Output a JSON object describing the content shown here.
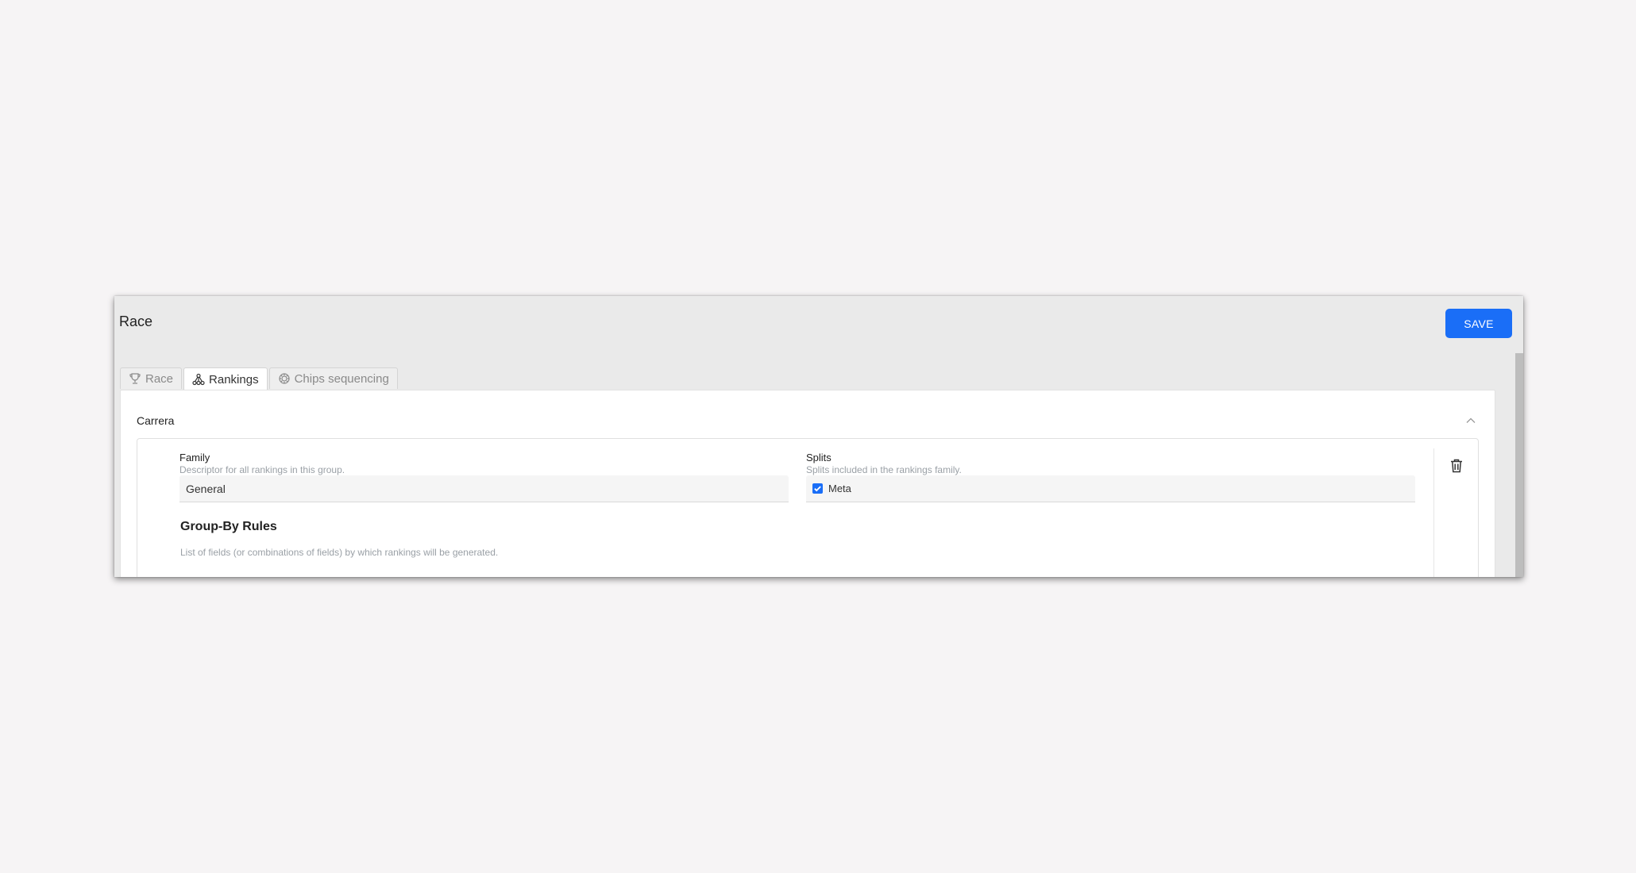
{
  "dialog": {
    "title": "Race",
    "save_label": "SAVE"
  },
  "tabs": [
    {
      "label": "Race",
      "icon": "trophy-icon",
      "active": false
    },
    {
      "label": "Rankings",
      "icon": "ranking-tree-icon",
      "active": true
    },
    {
      "label": "Chips sequencing",
      "icon": "chip-icon",
      "active": false
    }
  ],
  "section": {
    "title": "Carrera"
  },
  "family": {
    "label": "Family",
    "help": "Descriptor for all rankings in this group.",
    "value": "General"
  },
  "splits": {
    "label": "Splits",
    "help": "Splits included in the rankings family.",
    "option_label": "Meta",
    "checked": true
  },
  "group_by": {
    "title": "Group-By Rules",
    "help": "List of fields (or combinations of fields) by which rankings will be generated."
  },
  "colors": {
    "accent": "#1a6ef7",
    "page_bg": "#f6f4f5",
    "dialog_bg": "#eaeaea"
  }
}
